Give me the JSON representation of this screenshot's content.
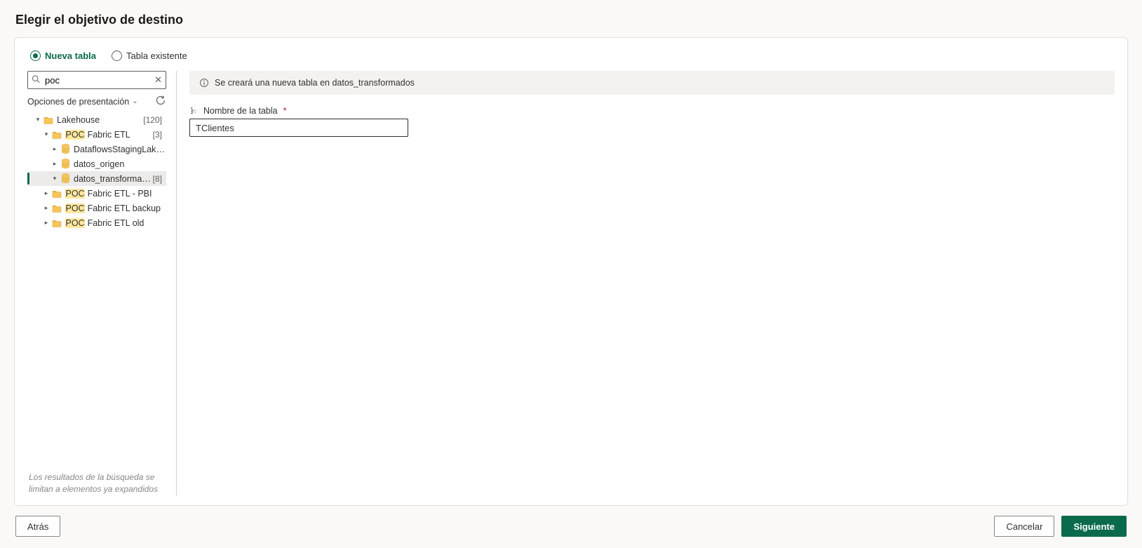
{
  "title": "Elegir el objetivo de destino",
  "tabs": {
    "new": "Nueva tabla",
    "existing": "Tabla existente"
  },
  "search": {
    "value": "poc",
    "placeholder": ""
  },
  "options_label": "Opciones de presentación",
  "tree": {
    "root": {
      "label": "Lakehouse",
      "count": "[120]"
    },
    "poc_etl": {
      "label_hl": "POC",
      "label_rest": " Fabric ETL",
      "count": "[3]"
    },
    "dfs": "DataflowsStagingLakehou…",
    "origen": "datos_origen",
    "transformados": {
      "label": "datos_transformados",
      "count": "[8]"
    },
    "pbi": {
      "label_hl": "POC",
      "label_rest": " Fabric ETL - PBI"
    },
    "backup": {
      "label_hl": "POC",
      "label_rest": " Fabric ETL backup"
    },
    "old": {
      "label_hl": "POC",
      "label_rest": " Fabric ETL old"
    }
  },
  "search_note": "Los resultados de la búsqueda se limitan a elementos ya expandidos",
  "info_banner": "Se creará una nueva tabla en datos_transformados",
  "table_name_label": "Nombre de la tabla",
  "table_name_value": "TClientes",
  "footer": {
    "back": "Atrás",
    "cancel": "Cancelar",
    "next": "Siguiente"
  }
}
